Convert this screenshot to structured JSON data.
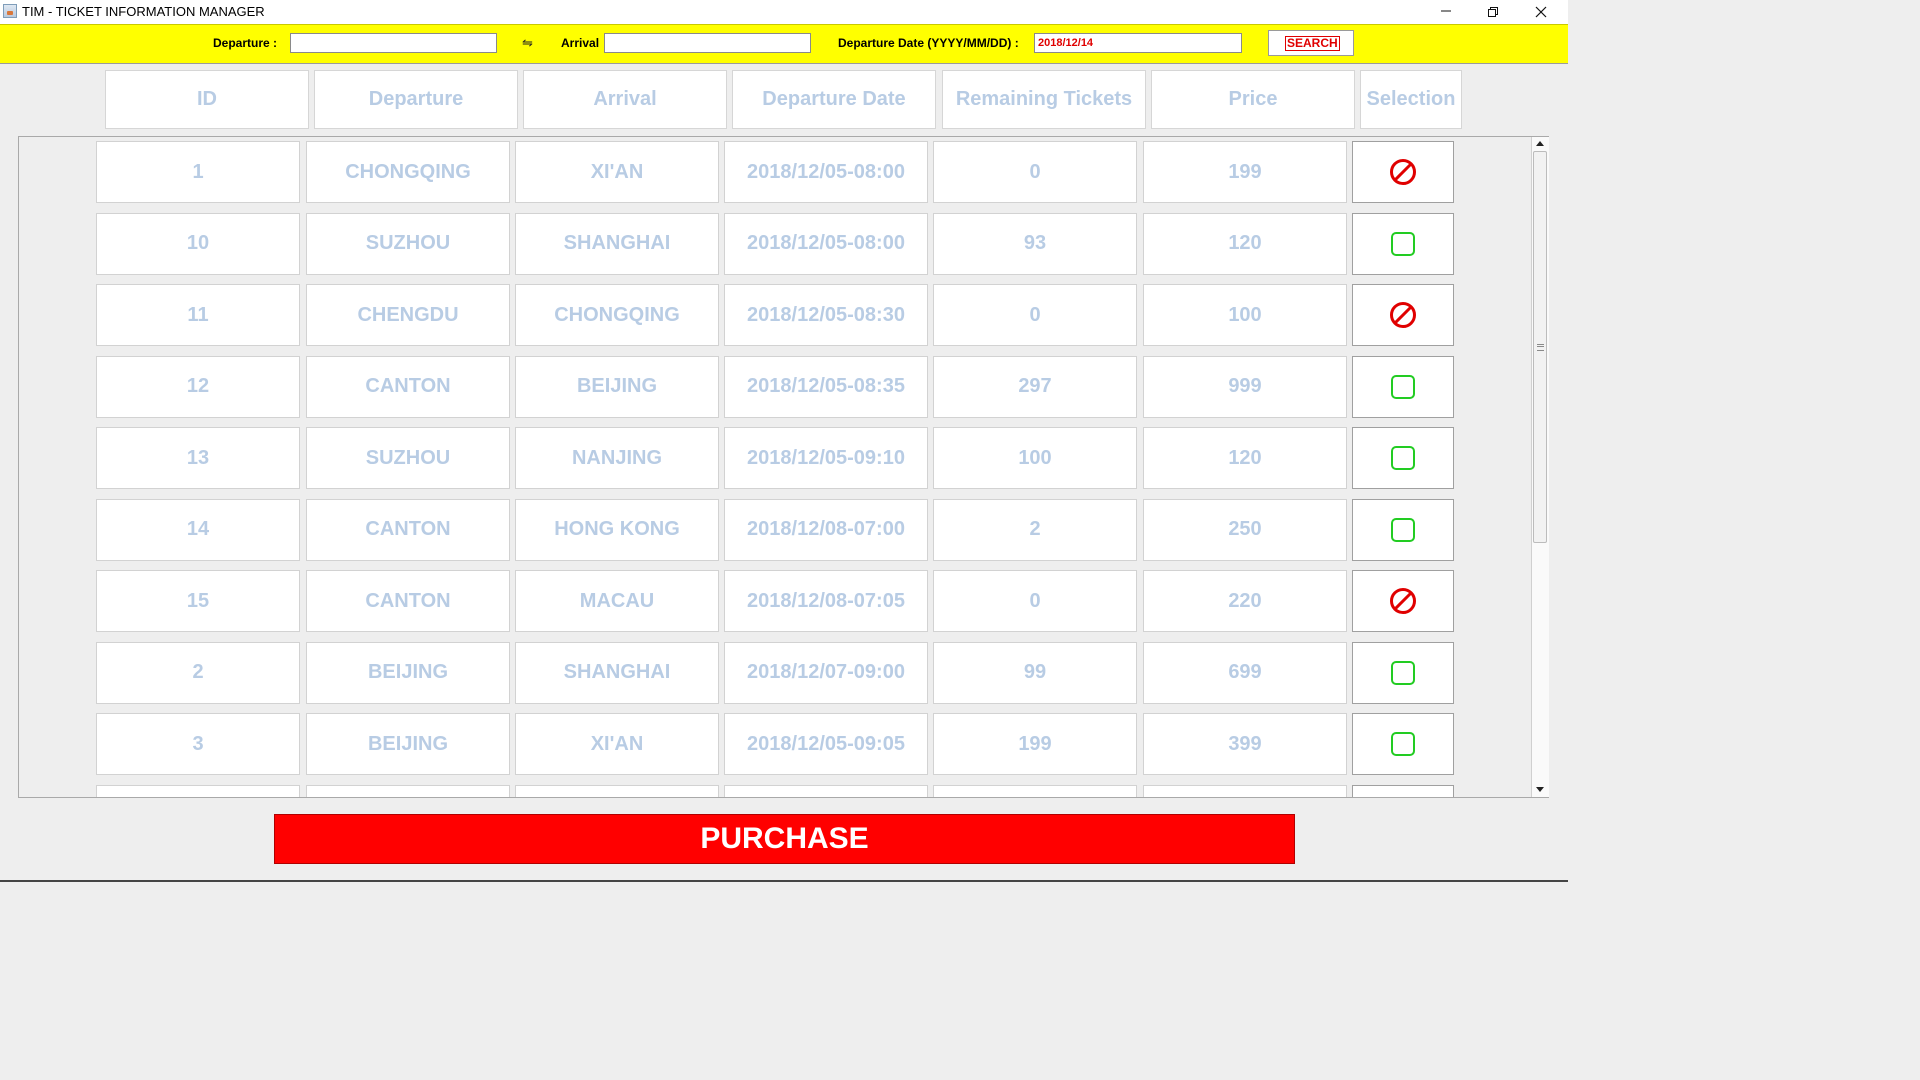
{
  "window": {
    "title": "TIM - TICKET INFORMATION MANAGER"
  },
  "search": {
    "departure_label": "Departure :",
    "departure_value": "",
    "swap_symbol": "⇋",
    "arrival_label": "Arrival",
    "arrival_value": "",
    "date_label": "Departure Date (YYYY/MM/DD) :",
    "date_value": "2018/12/14",
    "search_label": "SEARCH"
  },
  "table": {
    "headers": [
      "ID",
      "Departure",
      "Arrival",
      "Departure Date",
      "Remaining Tickets",
      "Price",
      "Selection"
    ],
    "rows": [
      {
        "id": "1",
        "departure": "CHONGQING",
        "arrival": "XI'AN",
        "date": "2018/12/05-08:00",
        "remaining": "0",
        "price": "199",
        "selection": "unavailable"
      },
      {
        "id": "10",
        "departure": "SUZHOU",
        "arrival": "SHANGHAI",
        "date": "2018/12/05-08:00",
        "remaining": "93",
        "price": "120",
        "selection": "available"
      },
      {
        "id": "11",
        "departure": "CHENGDU",
        "arrival": "CHONGQING",
        "date": "2018/12/05-08:30",
        "remaining": "0",
        "price": "100",
        "selection": "unavailable"
      },
      {
        "id": "12",
        "departure": "CANTON",
        "arrival": "BEIJING",
        "date": "2018/12/05-08:35",
        "remaining": "297",
        "price": "999",
        "selection": "available"
      },
      {
        "id": "13",
        "departure": "SUZHOU",
        "arrival": "NANJING",
        "date": "2018/12/05-09:10",
        "remaining": "100",
        "price": "120",
        "selection": "available"
      },
      {
        "id": "14",
        "departure": "CANTON",
        "arrival": "HONG KONG",
        "date": "2018/12/08-07:00",
        "remaining": "2",
        "price": "250",
        "selection": "available"
      },
      {
        "id": "15",
        "departure": "CANTON",
        "arrival": "MACAU",
        "date": "2018/12/08-07:05",
        "remaining": "0",
        "price": "220",
        "selection": "unavailable"
      },
      {
        "id": "2",
        "departure": "BEIJING",
        "arrival": "SHANGHAI",
        "date": "2018/12/07-09:00",
        "remaining": "99",
        "price": "699",
        "selection": "available"
      },
      {
        "id": "3",
        "departure": "BEIJING",
        "arrival": "XI'AN",
        "date": "2018/12/05-09:05",
        "remaining": "199",
        "price": "399",
        "selection": "available"
      }
    ]
  },
  "purchase": {
    "label": "PURCHASE"
  },
  "icons": {
    "available": "empty-checkbox-icon",
    "unavailable": "prohibited-icon"
  },
  "colors": {
    "search_bar": "#ffff00",
    "table_text": "#b8cce4",
    "purchase": "#ff0000",
    "available_icon": "#22cc22",
    "unavailable_icon": "#e00000",
    "date_value": "#e00000"
  }
}
